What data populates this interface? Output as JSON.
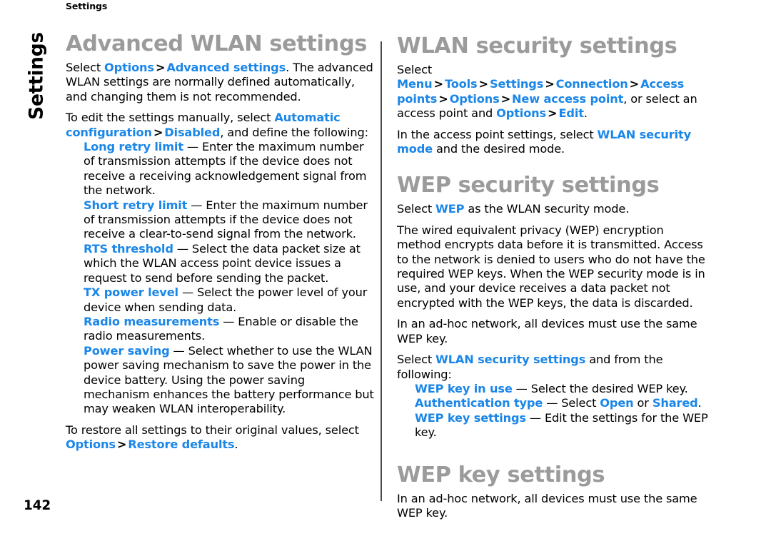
{
  "page": {
    "running_head": "Settings",
    "side_tab": "Settings",
    "folio": "142",
    "accent_color": "#1a86e8",
    "heading_color": "#9b9b9b",
    "divider_color": "#4a4a4a",
    "background": "#ffffff"
  },
  "left_column": {
    "heading": "Advanced WLAN settings",
    "p1": {
      "t1": "Select ",
      "ui1": "Options",
      "gt1": ">",
      "ui2": "Advanced settings",
      "t2": ". The advanced WLAN settings are normally defined automatically, and changing them is not recommended."
    },
    "p2": {
      "t1": "To edit the settings manually, select ",
      "ui1": "Automatic configuration",
      "gt1": ">",
      "ui2": "Disabled",
      "t2": ", and define the following:"
    },
    "definitions": [
      {
        "term": "Long retry limit",
        "dash": "—",
        "desc": "Enter the maximum number of transmission attempts if the device does not receive a receiving acknowledgement signal from the network."
      },
      {
        "term": "Short retry limit",
        "dash": "—",
        "desc": "Enter the maximum number of transmission attempts if the device does not receive a clear-to-send signal from the network."
      },
      {
        "term": "RTS threshold",
        "dash": "—",
        "desc": "Select the data packet size at which the WLAN access point device issues a request to send before sending the packet."
      },
      {
        "term": "TX power level",
        "dash": "—",
        "desc": "Select the power level of your device when sending data."
      },
      {
        "term": "Radio measurements",
        "dash": "—",
        "desc": "Enable or disable the radio measurements."
      },
      {
        "term": "Power saving",
        "dash": "—",
        "desc": "Select whether to use the WLAN power saving mechanism to save the power in the device battery. Using the power saving mechanism enhances the battery performance but may weaken WLAN interoperability."
      }
    ],
    "p3": {
      "t1": "To restore all settings to their original values, select ",
      "ui1": "Options",
      "gt1": ">",
      "ui2": "Restore defaults",
      "t2": "."
    }
  },
  "right_column": {
    "heading1": "WLAN security settings",
    "p1": {
      "t1": "Select ",
      "ui1": "Menu",
      "gt1": ">",
      "ui2": "Tools",
      "gt2": ">",
      "ui3": "Settings",
      "gt3": ">",
      "ui4": "Connection",
      "gt4": ">",
      "ui5": "Access points",
      "gt5": ">",
      "ui6": "Options",
      "gt6": ">",
      "ui7": "New access point",
      "t2": ", or select an access point and ",
      "ui8": "Options",
      "gt7": ">",
      "ui9": "Edit",
      "t3": "."
    },
    "p2": {
      "t1": "In the access point settings, select ",
      "ui1": "WLAN security mode",
      "t2": " and the desired mode."
    },
    "heading2": "WEP security settings",
    "p3": {
      "t1": "Select ",
      "ui1": "WEP",
      "t2": " as the WLAN security mode."
    },
    "p4": "The wired equivalent privacy (WEP) encryption method encrypts data before it is transmitted. Access to the network is denied to users who do not have the required WEP keys. When the WEP security mode is in use, and your device receives a data packet not encrypted with the WEP keys, the data is discarded.",
    "p5": "In an ad-hoc network, all devices must use the same WEP key.",
    "p6": {
      "t1": "Select ",
      "ui1": "WLAN security settings",
      "t2": " and from the following:"
    },
    "definitions": [
      {
        "term": "WEP key in use",
        "dash": "—",
        "desc": "Select the desired WEP key."
      },
      {
        "term": "Authentication type",
        "dash": "—",
        "desc_pre": "Select ",
        "ui_a": "Open",
        "desc_mid": " or ",
        "ui_b": "Shared",
        "desc_post": "."
      },
      {
        "term": "WEP key settings",
        "dash": "—",
        "desc": "Edit the settings for the WEP key."
      }
    ],
    "heading3": "WEP key settings",
    "p7": "In an ad-hoc network, all devices must use the same WEP key."
  }
}
